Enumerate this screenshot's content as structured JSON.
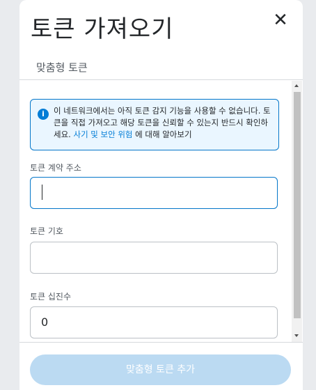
{
  "dialog": {
    "title": "토큰 가져오기",
    "close_icon": "close-icon",
    "tab_label": "맞춤형 토큰"
  },
  "notice": {
    "icon": "info-icon",
    "icon_glyph": "i",
    "text_before": "이 네트워크에서는 아직 토큰 감지 기능을 사용할 수 없습니다. 토큰을 직접 가져오고 해당 토큰을 신뢰할 수 있는지 반드시 확인하세요. ",
    "link_text": "사기 및 보안 위험",
    "text_after": " 에 대해 알아보기"
  },
  "form": {
    "address_label": "토큰 계약 주소",
    "address_value": "",
    "symbol_label": "토큰 기호",
    "symbol_value": "",
    "decimals_label": "토큰 십진수",
    "decimals_value": "0"
  },
  "footer": {
    "add_button_label": "맞춤형 토큰 추가"
  },
  "colors": {
    "accent": "#037dd6",
    "notice_bg": "#eaf6ff",
    "disabled_button": "#bbdaf2"
  }
}
